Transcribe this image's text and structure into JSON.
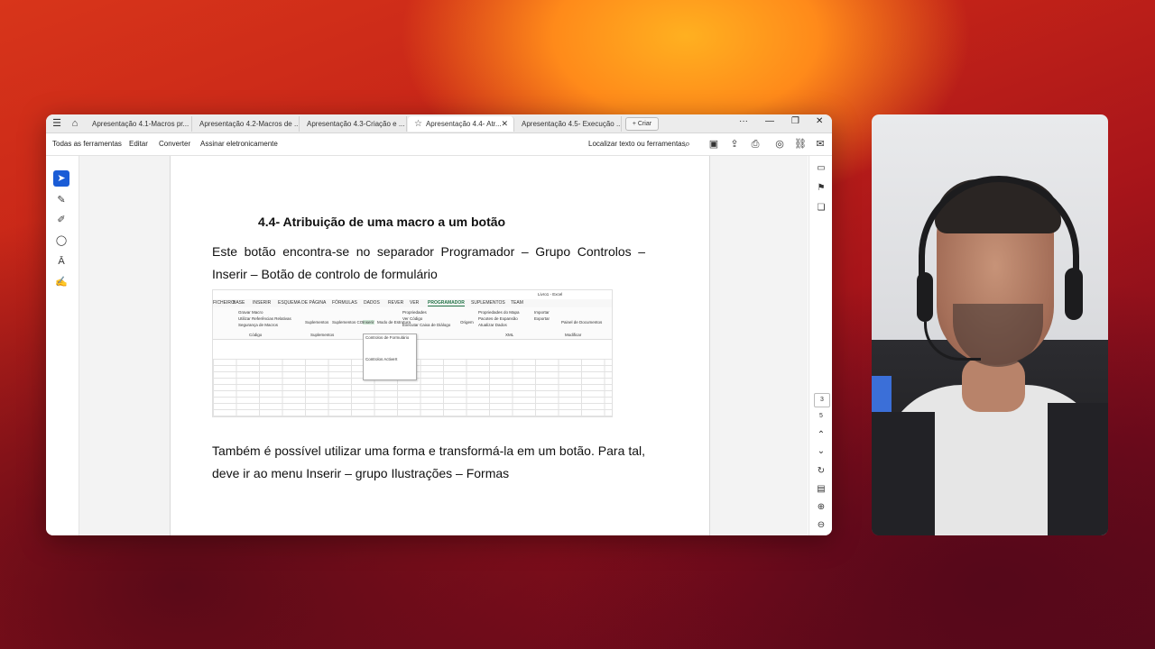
{
  "tabs": [
    {
      "label": "Apresentação 4.1-Macros pr..."
    },
    {
      "label": "Apresentação 4.2-Macros de ..."
    },
    {
      "label": "Apresentação 4.3-Criação e ..."
    },
    {
      "label": "Apresentação 4.4- Atr..."
    },
    {
      "label": "Apresentação 4.5- Execução ..."
    }
  ],
  "criar_label": "+ Criar",
  "menu": {
    "all_tools": "Todas as ferramentas",
    "edit": "Editar",
    "convert": "Converter",
    "sign": "Assinar eletronicamente",
    "find": "Localizar texto ou ferramentas"
  },
  "doc": {
    "heading": "4.4- Atribuição de uma macro a um botão",
    "para1": "Este botão encontra-se no separador Programador – Grupo Controlos – Inserir – Botão de controlo de formulário",
    "para2": "Também é possível utilizar uma forma e transformá-la em um botão. Para tal, deve ir ao menu Inserir – grupo Ilustrações – Formas"
  },
  "excel": {
    "title": "Livro1 - Excel",
    "ribbon_tabs": [
      "FICHEIRO",
      "BASE",
      "INSERIR",
      "ESQUEMA DE PÁGINA",
      "FÓRMULAS",
      "DADOS",
      "REVER",
      "VER",
      "PROGRAMADOR",
      "SUPLEMENTOS",
      "TEAM"
    ],
    "items": {
      "gravar": "Gravar Macro",
      "refs": "Utilizar Referências Relativas",
      "seg": "Segurança de Macros",
      "suplementos": "Suplementos",
      "suplementos_com": "Suplementos COM",
      "inserir": "Inserir",
      "modo": "Modo de Estrutura",
      "propriedades": "Propriedades",
      "ver_codigo": "Ver Código",
      "executar": "Executar Caixa de Diálogo",
      "origem": "Origem",
      "prop_mapa": "Propriedades do Mapa",
      "pacotes": "Pacotes de Expansão",
      "atualizar": "Atualizar Dados",
      "importar": "Importar",
      "exportar": "Exportar",
      "painel": "Painel de Documentos",
      "grp_codigo": "Código",
      "grp_suplementos": "Suplementos",
      "grp_xml": "XML",
      "grp_modificar": "Modificar",
      "popup_form": "Controlos de Formulário",
      "popup_activex": "Controlos ActiveX"
    },
    "columns": [
      "A",
      "B",
      "C",
      "D",
      "E",
      "F",
      "G",
      "H",
      "I",
      "J",
      "K",
      "L",
      "M",
      "N",
      "O",
      "P",
      "Q"
    ]
  },
  "page_nav": {
    "current": "3",
    "total": "5"
  },
  "colors": {
    "accent": "#1a5cd6",
    "excel_green": "#217346"
  }
}
